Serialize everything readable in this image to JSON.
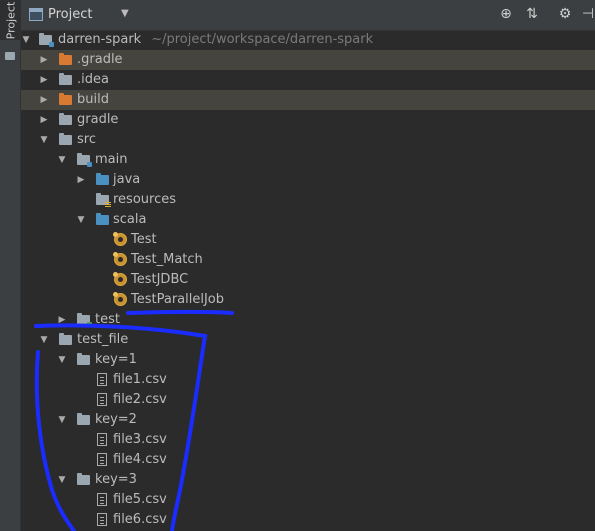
{
  "sidebar": {
    "tab_label": "Project"
  },
  "header": {
    "title": "Project",
    "caret_icon": "chevron-down-icon",
    "buttons": [
      {
        "name": "locate-icon",
        "glyph": "⊕"
      },
      {
        "name": "collapse-all-icon",
        "glyph": "⇅"
      },
      {
        "name": "settings-icon",
        "glyph": "⚙"
      },
      {
        "name": "hide-icon",
        "glyph": "⊣"
      }
    ]
  },
  "tree": {
    "root": {
      "label": "darren-spark",
      "path": "~/project/workspace/darren-spark"
    },
    "gradle_dot": ".gradle",
    "idea": ".idea",
    "build": "build",
    "gradle": "gradle",
    "src": "src",
    "main": "main",
    "java": "java",
    "resources": "resources",
    "scala": "scala",
    "scala_files": [
      "Test",
      "Test_Match",
      "TestJDBC",
      "TestParallelJob"
    ],
    "test": "test",
    "test_file": "test_file",
    "key1": "key=1",
    "key1_files": [
      "file1.csv",
      "file2.csv"
    ],
    "key2": "key=2",
    "key2_files": [
      "file3.csv",
      "file4.csv"
    ],
    "key3": "key=3",
    "key3_files": [
      "file5.csv",
      "file6.csv"
    ]
  },
  "colors": {
    "background": "#2b2b2b",
    "highlight_row": "#45443f",
    "excluded_folder": "#d87a32",
    "source_folder": "#4a90c2",
    "annotation_stroke": "#1a2cff"
  }
}
